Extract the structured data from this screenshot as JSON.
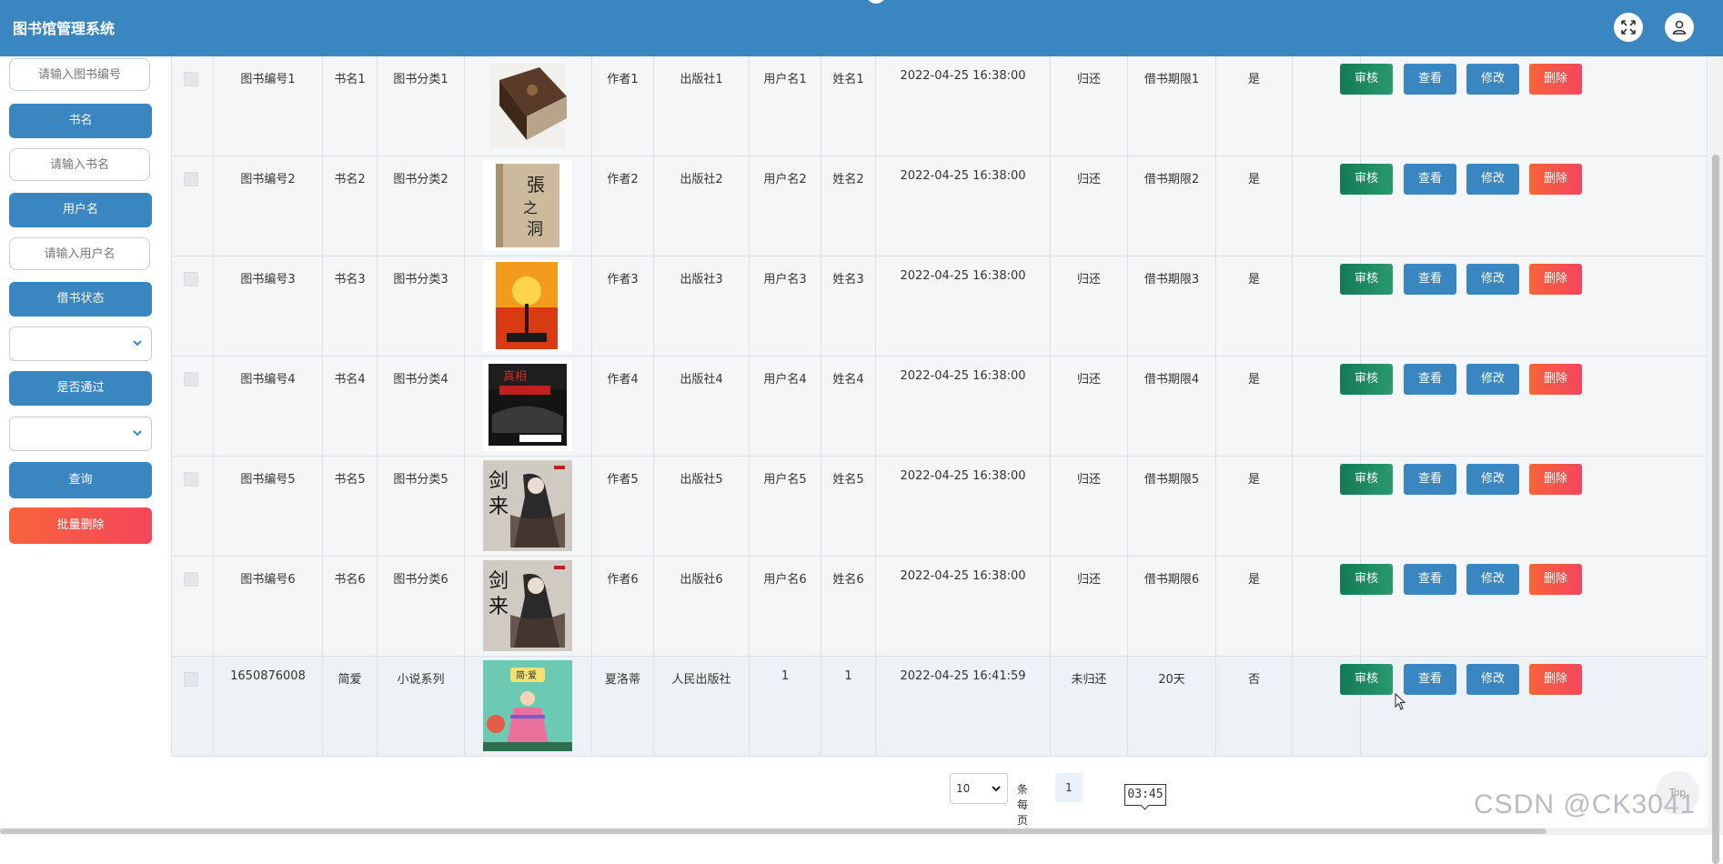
{
  "app": {
    "title": "图书馆管理系统"
  },
  "header_icons": [
    "expand-icon",
    "user-icon"
  ],
  "sidebar": {
    "book_no_placeholder": "请输入图书编号",
    "book_name_label": "书名",
    "book_name_placeholder": "请输入书名",
    "username_label": "用户名",
    "username_placeholder": "请输入用户名",
    "borrow_status_label": "借书状态",
    "borrow_status_value": "",
    "approved_label": "是否通过",
    "approved_value": "",
    "query_label": "查询",
    "batch_delete_label": "批量删除"
  },
  "actions": {
    "audit": "审核",
    "view": "查看",
    "edit": "修改",
    "delete": "删除"
  },
  "rows": [
    {
      "book_no": "图书编号1",
      "name": "书名1",
      "category": "图书分类1",
      "author": "作者1",
      "publisher": "出版社1",
      "username": "用户名1",
      "realname": "姓名1",
      "borrow_time": "2022-04-25 16:38:00",
      "status": "归还",
      "period": "借书期限1",
      "approved": "是",
      "cover": "dark-brown-book"
    },
    {
      "book_no": "图书编号2",
      "name": "书名2",
      "category": "图书分类2",
      "author": "作者2",
      "publisher": "出版社2",
      "username": "用户名2",
      "realname": "姓名2",
      "borrow_time": "2022-04-25 16:38:00",
      "status": "归还",
      "period": "借书期限2",
      "approved": "是",
      "cover": "beige-calligraphy-book"
    },
    {
      "book_no": "图书编号3",
      "name": "书名3",
      "category": "图书分类3",
      "author": "作者3",
      "publisher": "出版社3",
      "username": "用户名3",
      "realname": "姓名3",
      "borrow_time": "2022-04-25 16:38:00",
      "status": "归还",
      "period": "借书期限3",
      "approved": "是",
      "cover": "red-orange-scifi-book"
    },
    {
      "book_no": "图书编号4",
      "name": "书名4",
      "category": "图书分类4",
      "author": "作者4",
      "publisher": "出版社4",
      "username": "用户名4",
      "realname": "姓名4",
      "borrow_time": "2022-04-25 16:38:00",
      "status": "归还",
      "period": "借书期限4",
      "approved": "是",
      "cover": "black-red-mystery-book"
    },
    {
      "book_no": "图书编号5",
      "name": "书名5",
      "category": "图书分类5",
      "author": "作者5",
      "publisher": "出版社5",
      "username": "用户名5",
      "realname": "姓名5",
      "borrow_time": "2022-04-25 16:38:00",
      "status": "归还",
      "period": "借书期限5",
      "approved": "是",
      "cover": "ink-swordsman-book"
    },
    {
      "book_no": "图书编号6",
      "name": "书名6",
      "category": "图书分类6",
      "author": "作者6",
      "publisher": "出版社6",
      "username": "用户名6",
      "realname": "姓名6",
      "borrow_time": "2022-04-25 16:38:00",
      "status": "归还",
      "period": "借书期限6",
      "approved": "是",
      "cover": "ink-swordsman-book"
    },
    {
      "book_no": "1650876008",
      "name": "简爱",
      "category": "小说系列",
      "author": "夏洛蒂",
      "publisher": "人民出版社",
      "username": "1",
      "realname": "1",
      "borrow_time": "2022-04-25 16:41:59",
      "status": "未归还",
      "period": "20天",
      "approved": "否",
      "cover": "green-illustrated-book"
    }
  ],
  "pagination": {
    "page_size": "10",
    "per_page_label": "条每页",
    "current_page": "1"
  },
  "tooltip": {
    "time": "03:45"
  },
  "top_button": "Top",
  "watermark": "CSDN @CK3041"
}
